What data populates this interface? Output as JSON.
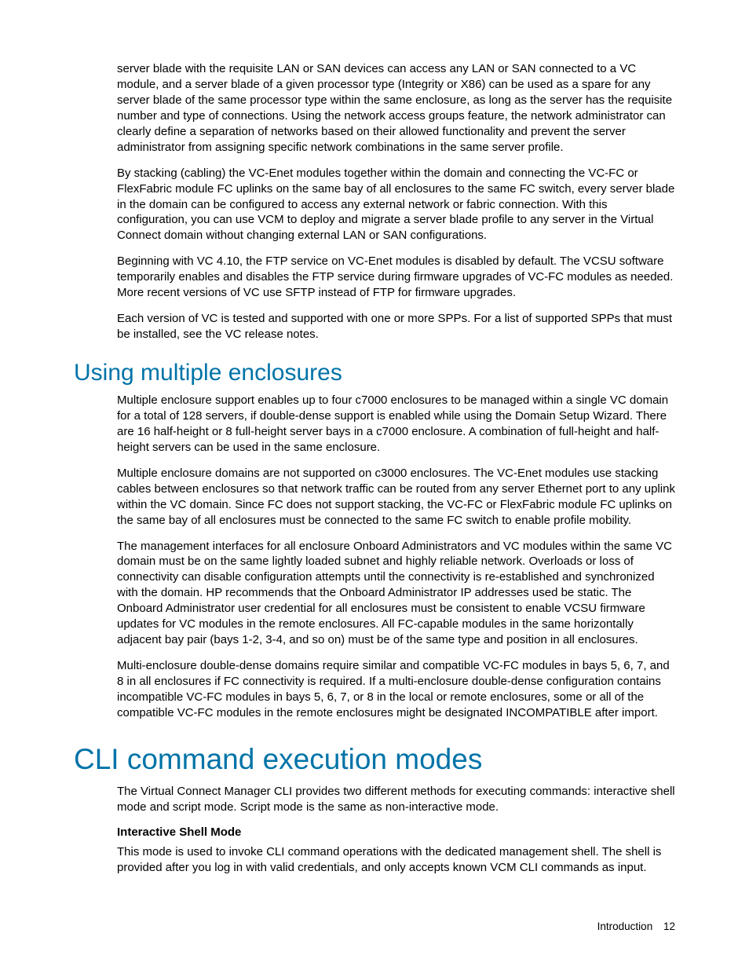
{
  "body": {
    "p1": "server blade with the requisite LAN or SAN devices can access any LAN or SAN connected to a VC module, and a server blade of a given processor type (Integrity or X86) can be used as a spare for any server blade of the same processor type within the same enclosure, as long as the server has the requisite number and type of connections. Using the network access groups feature, the network administrator can clearly define a separation of networks based on their allowed functionality and prevent the server administrator from assigning specific network combinations in the same server profile.",
    "p2": "By stacking (cabling) the VC-Enet modules together within the domain and connecting the VC-FC or FlexFabric module FC uplinks on the same bay of all enclosures to the same FC switch, every server blade in the domain can be configured to access any external network or fabric connection. With this configuration, you can use VCM to deploy and migrate a server blade profile to any server in the Virtual Connect domain without changing external LAN or SAN configurations.",
    "p3": "Beginning with VC 4.10, the FTP service on VC-Enet modules is disabled by default. The VCSU software temporarily enables and disables the FTP service during firmware upgrades of VC-FC modules as needed. More recent versions of VC use SFTP instead of FTP for firmware upgrades.",
    "p4": "Each version of VC is tested and supported with one or more SPPs. For a list of supported SPPs that must be installed, see the VC release notes."
  },
  "section1": {
    "heading": "Using multiple enclosures",
    "p1": "Multiple enclosure support enables up to four c7000 enclosures to be managed within a single VC domain for a total of 128 servers, if double-dense support is enabled while using the Domain Setup Wizard. There are 16 half-height or 8 full-height server bays in a c7000 enclosure. A combination of full-height and half-height servers can be used in the same enclosure.",
    "p2": "Multiple enclosure domains are not supported on c3000 enclosures. The VC-Enet modules use stacking cables between enclosures so that network traffic can be routed from any server Ethernet port to any uplink within the VC domain. Since FC does not support stacking, the VC-FC or FlexFabric module FC uplinks on the same bay of all enclosures must be connected to the same FC switch to enable profile mobility.",
    "p3": "The management interfaces for all enclosure Onboard Administrators and VC modules within the same VC domain must be on the same lightly loaded subnet and highly reliable network. Overloads or loss of connectivity can disable configuration attempts until the connectivity is re-established and synchronized with the domain. HP recommends that the Onboard Administrator IP addresses used be static. The Onboard Administrator user credential for all enclosures must be consistent to enable VCSU firmware updates for VC modules in the remote enclosures. All FC-capable modules in the same horizontally adjacent bay pair (bays 1-2, 3-4, and so on) must be of the same type and position in all enclosures.",
    "p4": "Multi-enclosure double-dense domains require similar and compatible VC-FC modules in bays 5, 6, 7, and 8 in all enclosures if FC connectivity is required. If a multi-enclosure double-dense configuration contains incompatible VC-FC modules in bays 5, 6, 7, or 8 in the local or remote enclosures, some or all of the compatible VC-FC modules in the remote enclosures might be designated INCOMPATIBLE after import."
  },
  "section2": {
    "heading": "CLI command execution modes",
    "p1": "The Virtual Connect Manager CLI provides two different methods for executing commands: interactive shell mode and script mode. Script mode is the same as non-interactive mode.",
    "sub1": "Interactive Shell Mode",
    "p2": "This mode is used to invoke CLI command operations with the dedicated management shell. The shell is provided after you log in with valid credentials, and only accepts known VCM CLI commands as input."
  },
  "footer": {
    "label": "Introduction",
    "page": "12"
  }
}
